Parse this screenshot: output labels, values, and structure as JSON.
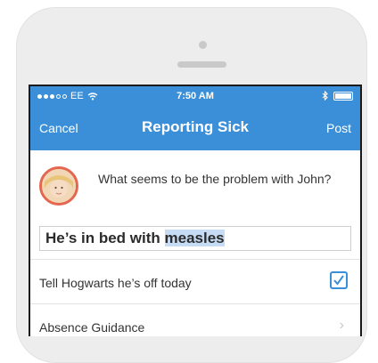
{
  "status_bar": {
    "carrier": "EE",
    "time": "7:50 AM"
  },
  "nav": {
    "cancel_label": "Cancel",
    "title": "Reporting Sick",
    "post_label": "Post"
  },
  "question": {
    "text": "What seems to be the problem with John?"
  },
  "answer": {
    "value_prefix": "He’s in bed with ",
    "value_selected": "measles"
  },
  "rows": [
    {
      "label": "Tell Hogwarts he’s off today",
      "checked": true
    },
    {
      "label": "Absence Guidance"
    }
  ],
  "colors": {
    "accent": "#3a8fd8",
    "avatar_ring": "#e4664f"
  }
}
